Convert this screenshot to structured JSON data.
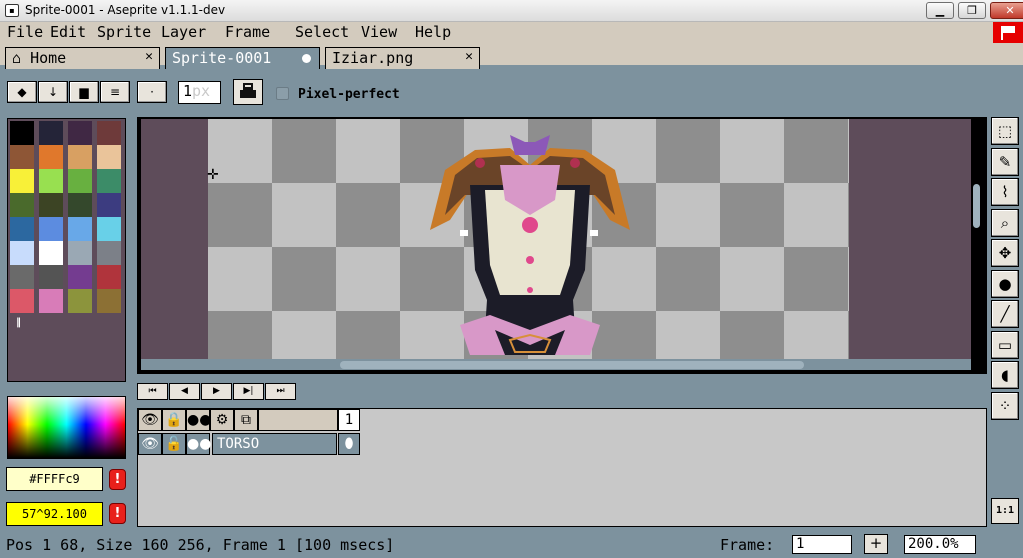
{
  "window": {
    "title": "Sprite-0001 - Aseprite v1.1.1-dev",
    "app_icon": "aseprite-icon",
    "controls": {
      "minimize": "▁",
      "maximize": "❐",
      "close": "✕"
    }
  },
  "menu": {
    "items": [
      "File",
      "Edit",
      "Sprite",
      "Layer",
      "Frame",
      "Select",
      "View",
      "Help"
    ],
    "flag_icon": "aseprite-flag-icon"
  },
  "tabs": [
    {
      "label": "Home",
      "icon": "home-icon",
      "close": "✕"
    },
    {
      "label": "Sprite-0001",
      "modified": true
    },
    {
      "label": "Iziar.png",
      "close": "✕"
    }
  ],
  "context_bar": {
    "buttons": [
      {
        "icon": "eraser-icon",
        "glyph": "◆"
      },
      {
        "icon": "arrow-down-icon",
        "glyph": "↓"
      },
      {
        "icon": "folder-icon",
        "glyph": "▆"
      },
      {
        "icon": "list-icon",
        "glyph": "≡"
      },
      {
        "icon": "brush-dot-icon",
        "glyph": "·"
      }
    ],
    "brush_size": "1",
    "brush_unit": "px",
    "ink_icon": "ink-icon",
    "pixel_perfect_checked": false,
    "pixel_perfect_label": "Pixel-perfect"
  },
  "palette": {
    "colors": [
      "#000000",
      "#242438",
      "#402844",
      "#6e3a3a",
      "#8e5636",
      "#e0782c",
      "#d8a062",
      "#eac49a",
      "#f8f038",
      "#98e050",
      "#68b040",
      "#3c8c68",
      "#4a6a2c",
      "#3c4424",
      "#34482c",
      "#3c3c80",
      "#2c68a0",
      "#5c8ce0",
      "#68a8e8",
      "#68d0e8",
      "#c8dcfc",
      "#ffffff",
      "#9aa8b4",
      "#7c8088",
      "#6a6a6a",
      "#545454",
      "#743c90",
      "#b0343c",
      "#dc5868",
      "#d87cb8",
      "#8c943c",
      "#8c7034"
    ],
    "size_icon": "palette-size-icon"
  },
  "color_fields": {
    "foreground": "#FFFFc9",
    "foreground_color": "#ffffc9",
    "background": "57^92.100",
    "background_color": "#ffff00",
    "warning": "!"
  },
  "toolbar": {
    "tools": [
      {
        "name": "rectangular-marquee-icon",
        "glyph": "⬚"
      },
      {
        "name": "pencil-icon",
        "glyph": "✎"
      },
      {
        "name": "eyedropper-icon",
        "glyph": "⌇"
      },
      {
        "name": "zoom-icon",
        "glyph": "⌕"
      },
      {
        "name": "move-icon",
        "glyph": "✥"
      },
      {
        "name": "paint-bucket-icon",
        "glyph": "●"
      },
      {
        "name": "line-icon",
        "glyph": "╱"
      },
      {
        "name": "rectangle-icon",
        "glyph": "▭"
      },
      {
        "name": "contour-icon",
        "glyph": "◖"
      },
      {
        "name": "spray-icon",
        "glyph": "⁘"
      }
    ],
    "zoom_reset": "1:1"
  },
  "timeline": {
    "controls": [
      {
        "name": "first-frame-icon",
        "glyph": "⏮"
      },
      {
        "name": "prev-frame-icon",
        "glyph": "◀"
      },
      {
        "name": "play-icon",
        "glyph": "▶"
      },
      {
        "name": "next-frame-icon",
        "glyph": "▶|"
      },
      {
        "name": "last-frame-icon",
        "glyph": "⏭"
      }
    ],
    "header_icons": [
      {
        "name": "eye-icon",
        "glyph": "👁"
      },
      {
        "name": "lock-icon",
        "glyph": "🔒"
      },
      {
        "name": "onion-skin-icon",
        "glyph": "●●"
      },
      {
        "name": "gear-icon",
        "glyph": "⚙"
      },
      {
        "name": "link-icon",
        "glyph": "⧉"
      }
    ],
    "frame_number": "1",
    "layer": {
      "name": "TORSO",
      "icons": [
        {
          "name": "eye-icon",
          "glyph": "👁"
        },
        {
          "name": "unlock-icon",
          "glyph": "🔓"
        },
        {
          "name": "continuous-icon",
          "glyph": "●●"
        }
      ],
      "cel": "⬮"
    }
  },
  "status": {
    "text": "Pos 1 68, Size 160 256, Frame 1 [100 msecs]",
    "frame_label": "Frame:",
    "frame_value": "1",
    "add_frame": "+",
    "zoom": "200.0%"
  }
}
